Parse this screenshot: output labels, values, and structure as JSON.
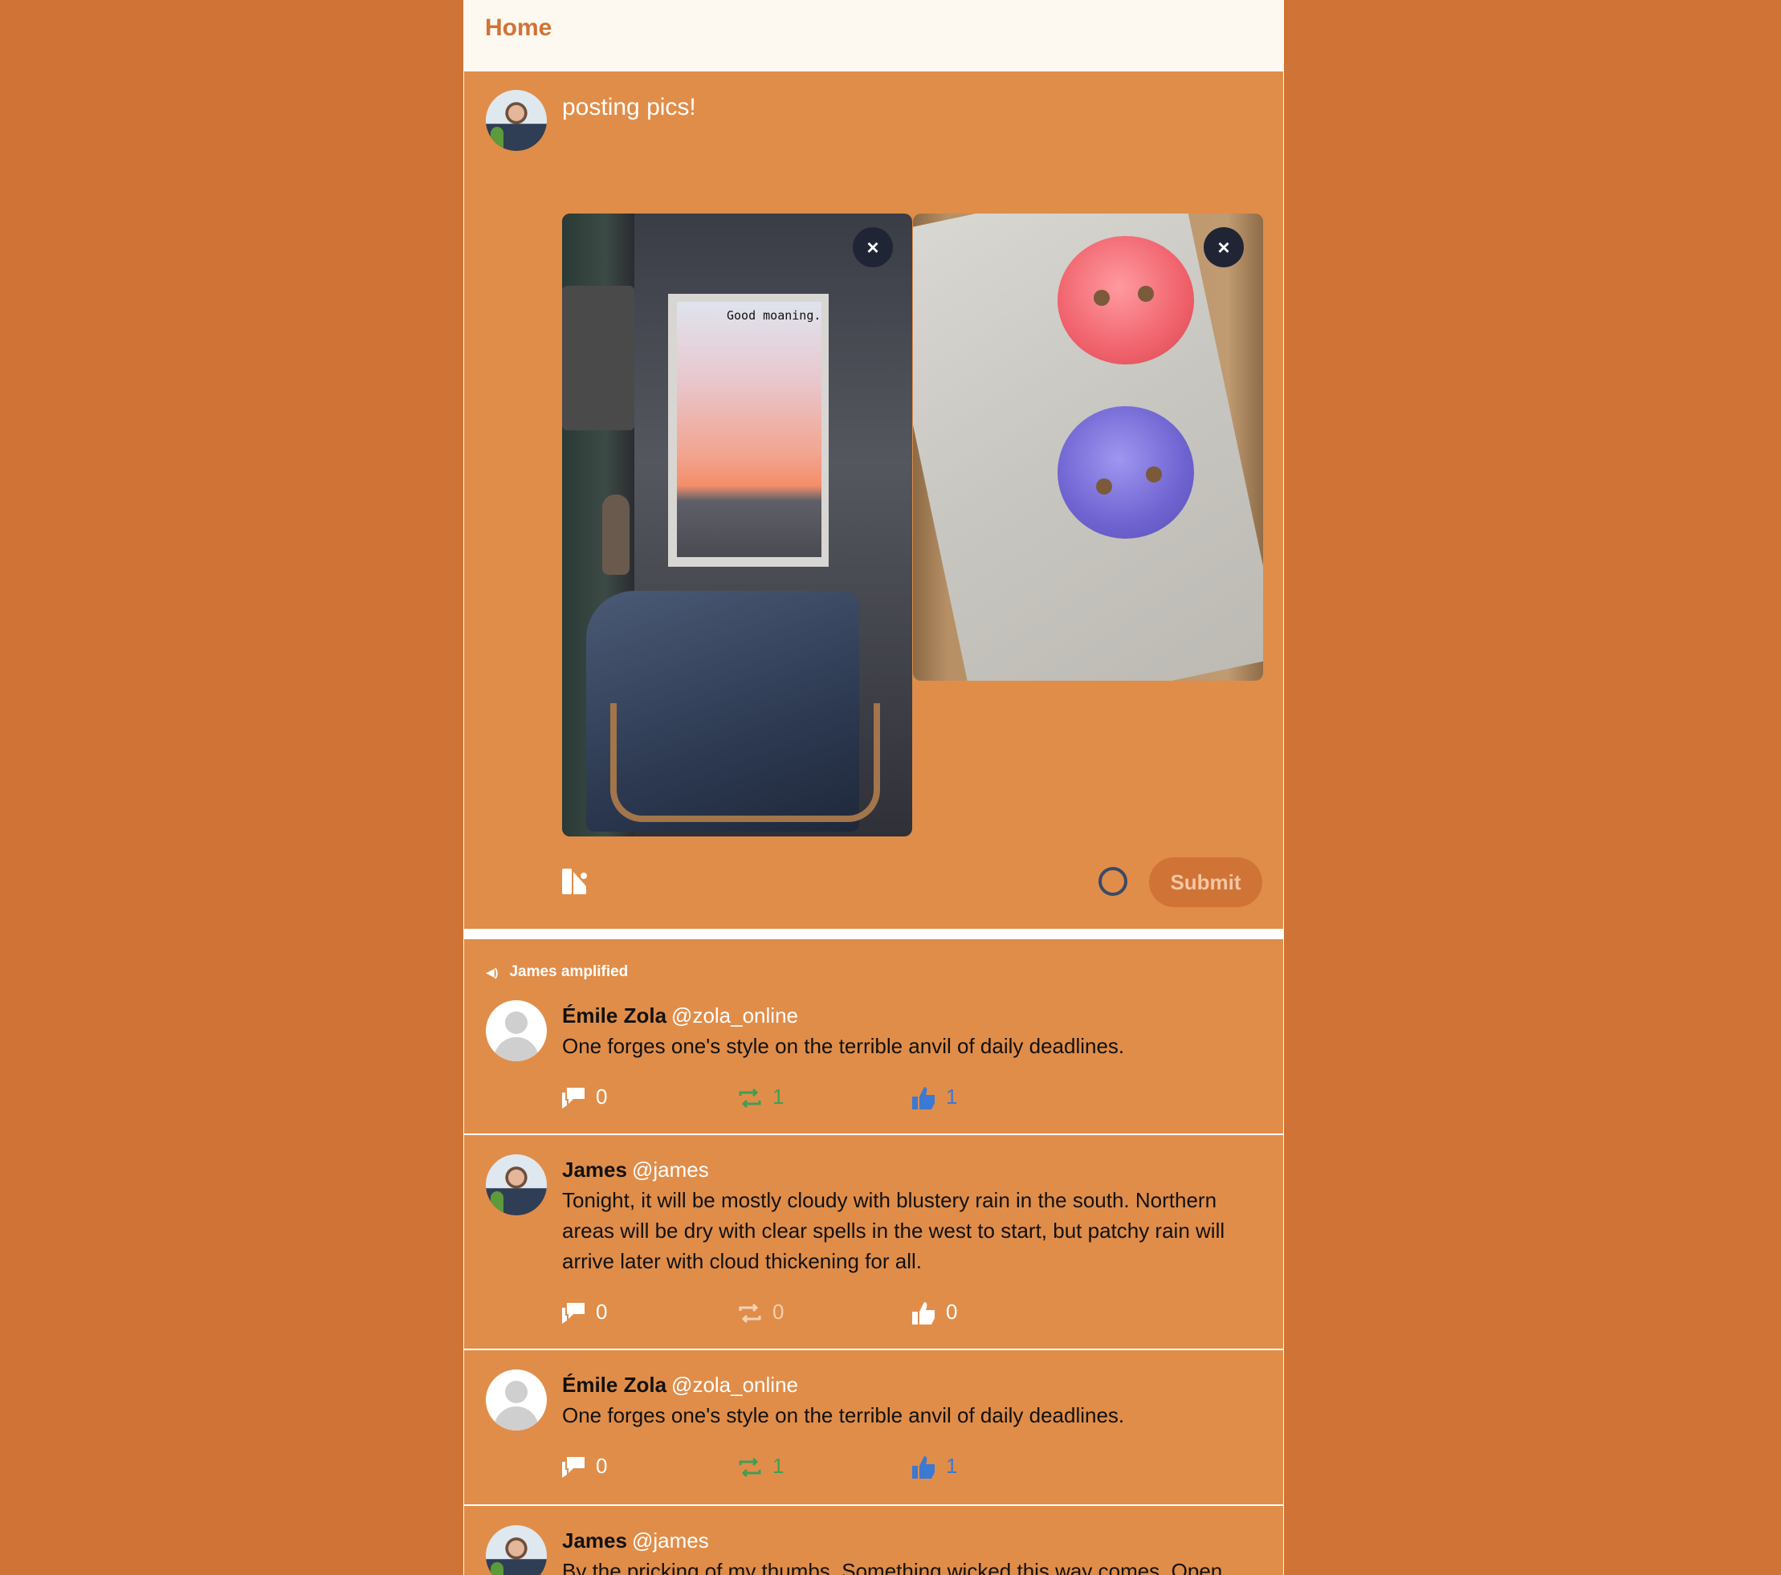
{
  "header": {
    "title": "Home"
  },
  "composer": {
    "text": "posting pics!",
    "images": [
      {
        "caption": "Good moaning.",
        "remove_label": "×"
      },
      {
        "caption": "",
        "remove_label": "×"
      }
    ],
    "submit_label": "Submit"
  },
  "posts": [
    {
      "reposted_by": "James amplified",
      "name": "Émile Zola",
      "handle": "@zola_online",
      "text": "One forges one's style on the terrible anvil of daily deadlines.",
      "replies": "0",
      "reposts": "1",
      "likes": "1"
    },
    {
      "name": "James",
      "handle": "@james",
      "text": "Tonight, it will be mostly cloudy with blustery rain in the south. Northern areas will be dry with clear spells in the west to start, but patchy rain will arrive later with cloud thickening for all.",
      "replies": "0",
      "reposts": "0",
      "likes": "0"
    },
    {
      "name": "Émile Zola",
      "handle": "@zola_online",
      "text": "One forges one's style on the terrible anvil of daily deadlines.",
      "replies": "0",
      "reposts": "1",
      "likes": "1"
    },
    {
      "name": "James",
      "handle": "@james",
      "text": "By the pricking of my thumbs. Something wicked this way comes. Open"
    }
  ],
  "colors": {
    "page_bg": "#D07336",
    "panel_bg": "#E08D49",
    "header_bg": "#FDF8F0",
    "accent": "#D07336",
    "repost_active": "#3E9E57",
    "like_active": "#3C79D2"
  },
  "icons": {
    "reply": "reply-icon",
    "repost": "repost-icon",
    "like": "thumbs-up-icon",
    "media": "media-icon",
    "amplify": "speaker-icon",
    "remove": "close-icon"
  }
}
